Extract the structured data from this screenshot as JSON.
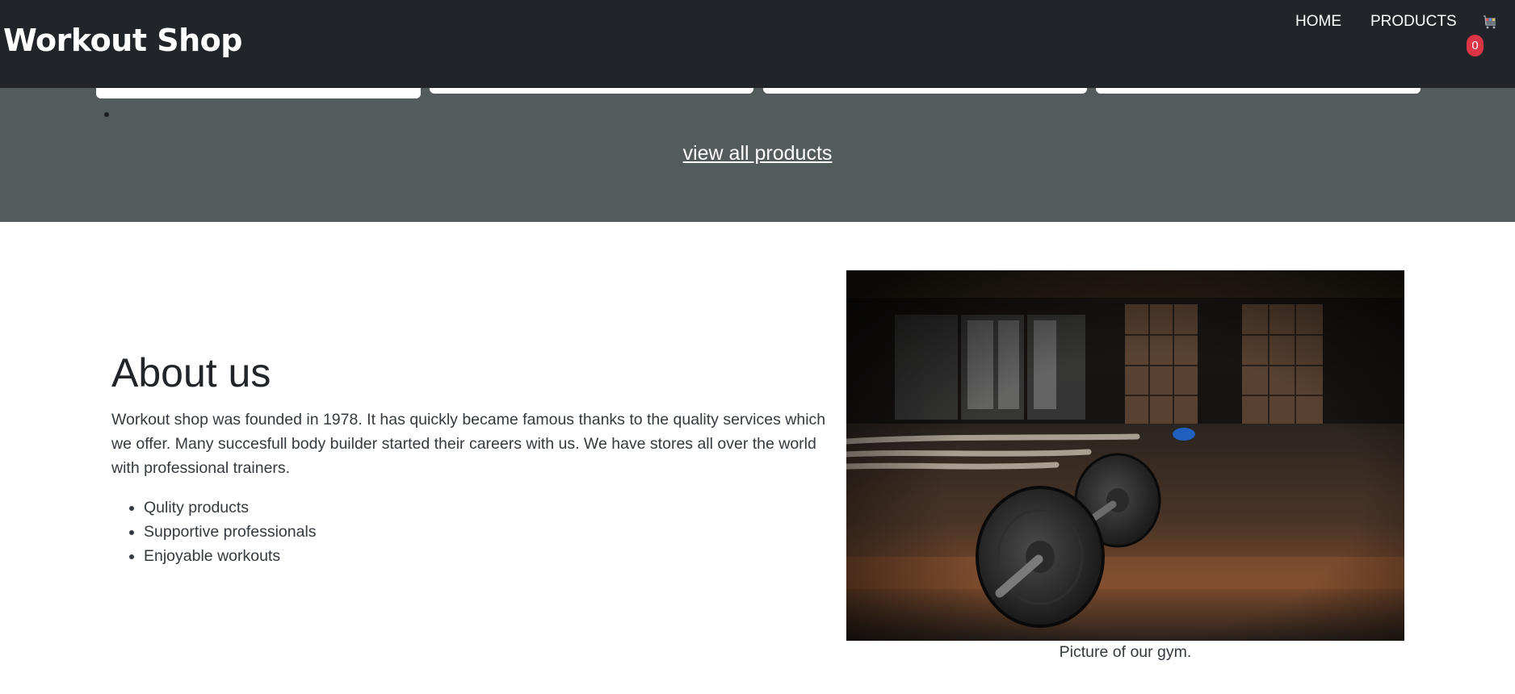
{
  "nav": {
    "brand": "Workout Shop",
    "links": [
      "HOME",
      "PRODUCTS"
    ],
    "cart_count": "0",
    "cart_icon": "shopping-cart-icon",
    "badge_color": "#dc3545"
  },
  "products_section": {
    "view_all_label": "view all products"
  },
  "about": {
    "title": "About us",
    "text": "Workout shop was founded in 1978. It has quickly became famous thanks to the quality services which we offer. Many succesfull body builder started their careers with us. We have stores all over the world with professional trainers.",
    "features": [
      "Qulity products",
      "Supportive professionals",
      "Enjoyable workouts"
    ]
  },
  "picture": {
    "caption": "Picture of our gym."
  },
  "colors": {
    "navbar": "#212529",
    "products_band": "#545b5c",
    "text": "#343a40"
  }
}
